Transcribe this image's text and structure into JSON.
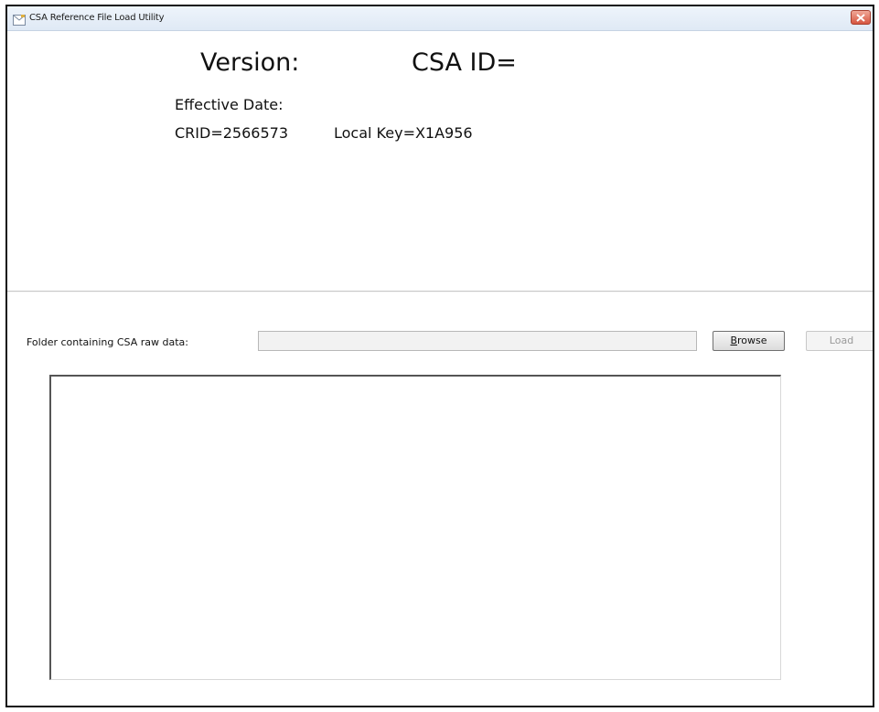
{
  "window": {
    "title": "CSA Reference File Load Utility"
  },
  "header": {
    "version_label": "Version:",
    "csa_id_label": "CSA ID=",
    "effective_date_label": "Effective Date:",
    "crid_label": "CRID=2566573",
    "local_key_label": "Local Key=X1A956"
  },
  "load_panel": {
    "folder_label": "Folder containing CSA raw data:",
    "folder_value": "",
    "browse_label_prefix": "",
    "browse_label_accel": "B",
    "browse_label_rest": "rowse",
    "load_label": "Load",
    "load_enabled": false
  },
  "log": {
    "text": ""
  },
  "colors": {
    "close_button": "#d65640",
    "disabled_text": "#9a9a9a"
  },
  "icons": {
    "app": "window-app-icon",
    "close": "close-icon"
  }
}
